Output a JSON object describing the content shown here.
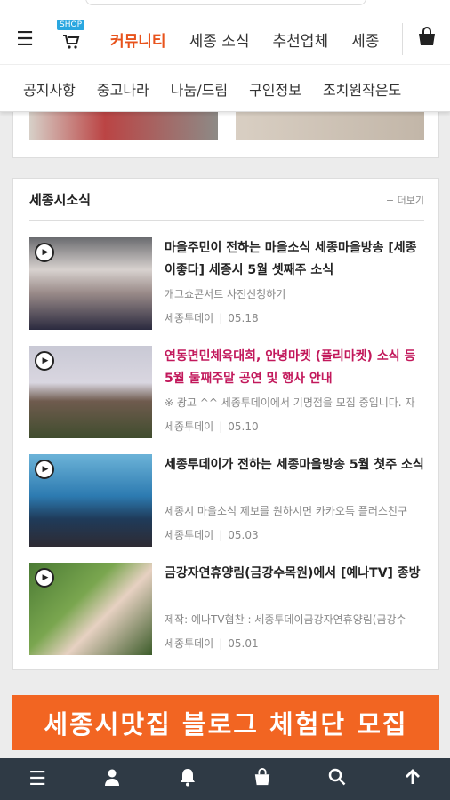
{
  "header": {
    "shop_badge": "SHOP",
    "nav_tabs": [
      {
        "label": "커뮤니티",
        "active": true
      },
      {
        "label": "세종 소식"
      },
      {
        "label": "추천업체"
      },
      {
        "label": "세종"
      }
    ],
    "sub_nav": [
      "공지사항",
      "중고나라",
      "나눔/드림",
      "구인정보",
      "조치원작은도"
    ]
  },
  "news": {
    "title": "세종시소식",
    "more": "+ 더보기",
    "articles": [
      {
        "title": "마을주민이 전하는 마을소식 세종마을방송 [세종이좋다] 세종시 5월 셋째주 소식",
        "desc": "개그쇼콘서트 사전신청하기",
        "source": "세종투데이",
        "date": "05.18"
      },
      {
        "title": "연동면민체육대회, 안녕마켓 (플리마켓) 소식 등 5월 둘째주말 공연 및 행사 안내",
        "desc": "※ 광고 ^^ 세종투데이에서 기명점을 모집 중입니다. 자",
        "source": "세종투데이",
        "date": "05.10"
      },
      {
        "title": "세종투데이가 전하는 세종마을방송 5월 첫주 소식",
        "desc": "세종시 마을소식 제보를 원하시면 카카오톡 플러스친구",
        "source": "세종투데이",
        "date": "05.03"
      },
      {
        "title": "금강자연휴양림(금강수목원)에서 [예나TV] 종방",
        "desc": "제작: 예나TV협찬 : 세종투데이금강자연휴양림(금강수",
        "source": "세종투데이",
        "date": "05.01"
      }
    ]
  },
  "banner": {
    "text": "세종시맛집 블로그 체험단 모집",
    "color": "#f26522"
  },
  "colors": {
    "accent": "#e8531c",
    "highlight": "#c2185b",
    "bottom_bar": "#2f3a45",
    "shop_badge": "#2aa7e0"
  },
  "icons": {
    "menu": "hamburger-icon",
    "shop": "cart-icon",
    "bag": "shopping-bag-icon",
    "bottom": [
      "hamburger-icon",
      "user-icon",
      "bell-icon",
      "shopping-bag-icon",
      "search-icon",
      "arrow-up-icon"
    ]
  }
}
